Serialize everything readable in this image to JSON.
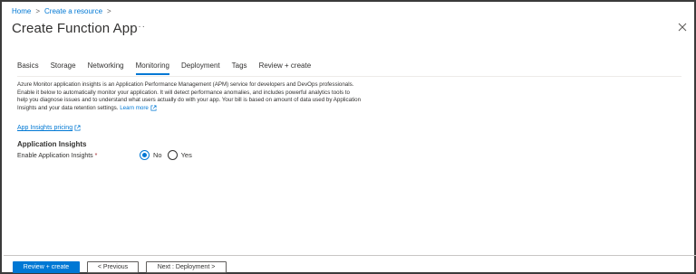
{
  "breadcrumb": {
    "home": "Home",
    "sep": ">",
    "create_resource": "Create a resource"
  },
  "page": {
    "title": "Create Function App",
    "more": "···"
  },
  "tabs": [
    {
      "label": "Basics"
    },
    {
      "label": "Storage"
    },
    {
      "label": "Networking"
    },
    {
      "label": "Monitoring",
      "active": true
    },
    {
      "label": "Deployment"
    },
    {
      "label": "Tags"
    },
    {
      "label": "Review + create"
    }
  ],
  "description": {
    "text": "Azure Monitor application insights is an Application Performance Management (APM) service for developers and DevOps professionals. Enable it below to automatically monitor your application. It will detect performance anomalies, and includes powerful analytics tools to help you diagnose issues and to understand what users actually do with your app. Your bill is based on amount of data used by Application Insights and your data retention settings.",
    "learn_more": "Learn more"
  },
  "pricing_link": "App Insights pricing",
  "section": {
    "title": "Application Insights"
  },
  "field": {
    "label": "Enable Application Insights",
    "required_mark": "*",
    "options": [
      {
        "label": "No",
        "checked": true
      },
      {
        "label": "Yes",
        "checked": false
      }
    ]
  },
  "footer": {
    "review_create": "Review + create",
    "previous": "< Previous",
    "next": "Next : Deployment >"
  },
  "colors": {
    "accent": "#0078d4",
    "text": "#323130",
    "required": "#a4262c"
  }
}
